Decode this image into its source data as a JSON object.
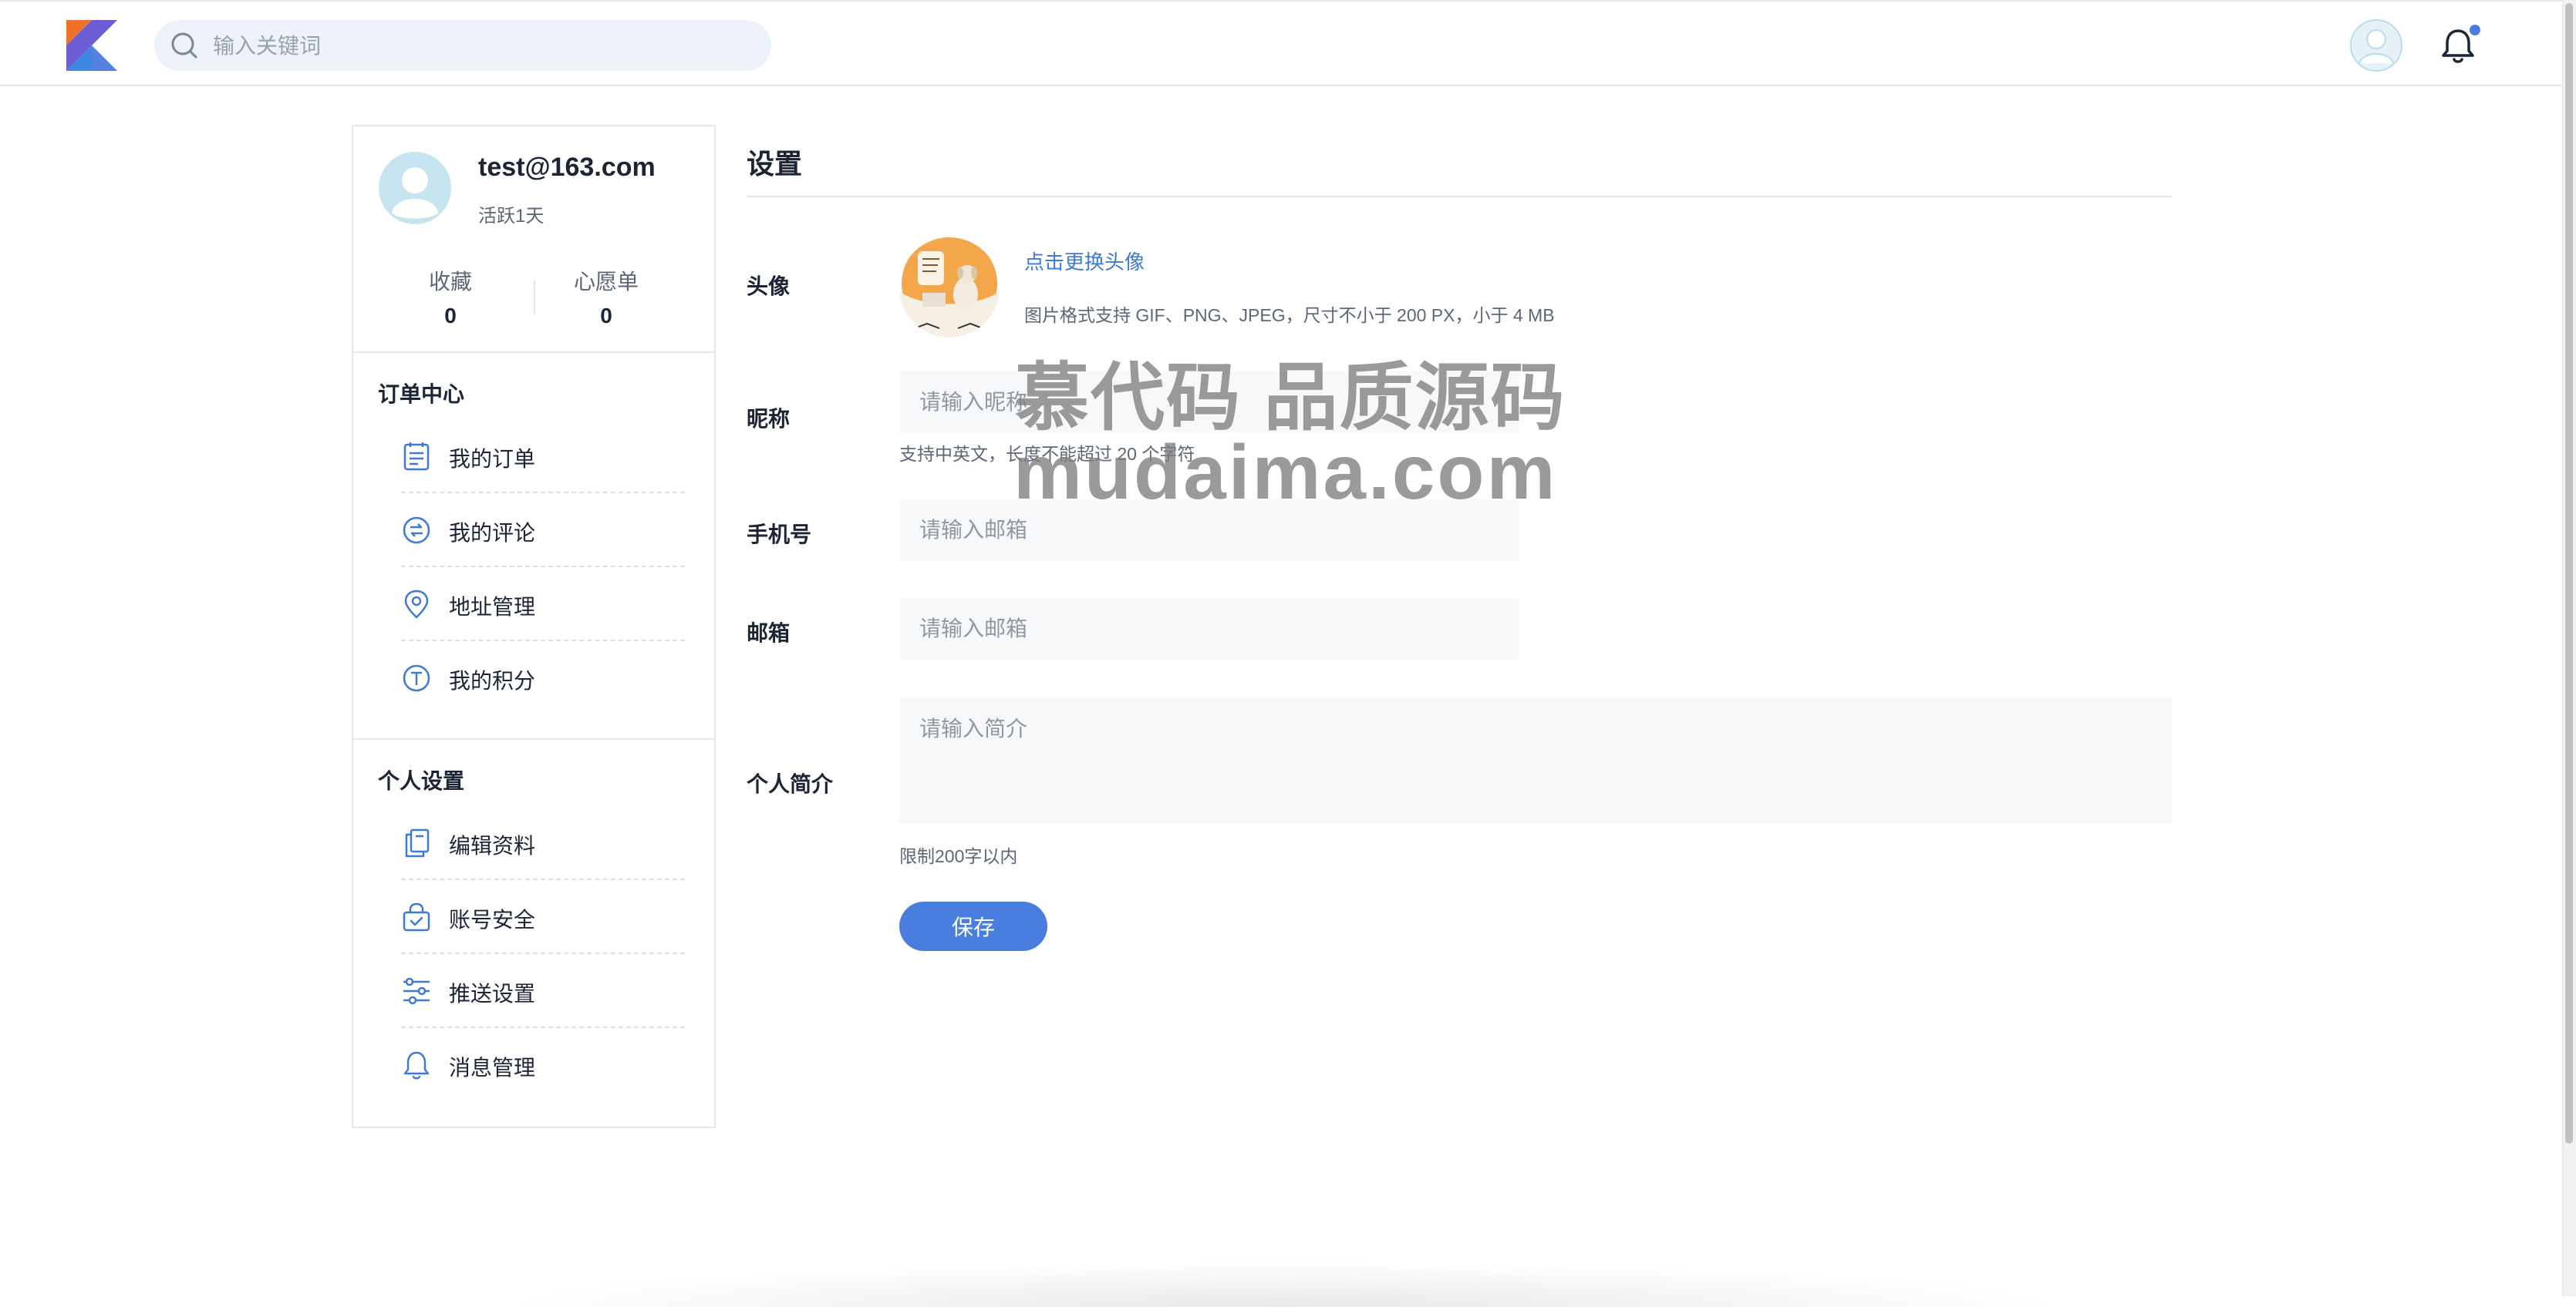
{
  "header": {
    "search_placeholder": "输入关键词",
    "brand_colors": [
      "#f0712a",
      "#6c5fd6",
      "#3f86de"
    ],
    "accent": "#4a7ede",
    "notification_dot": true
  },
  "sidebar": {
    "email": "test@163.com",
    "active": "活跃1天",
    "stats": [
      {
        "label": "收藏",
        "value": "0"
      },
      {
        "label": "心愿单",
        "value": "0"
      }
    ],
    "sections": [
      {
        "title": "订单中心",
        "items": [
          {
            "label": "我的订单",
            "icon": "order-list-icon"
          },
          {
            "label": "我的评论",
            "icon": "comment-icon"
          },
          {
            "label": "地址管理",
            "icon": "location-icon"
          },
          {
            "label": "我的积分",
            "icon": "points-icon"
          }
        ]
      },
      {
        "title": "个人设置",
        "items": [
          {
            "label": "编辑资料",
            "icon": "edit-profile-icon"
          },
          {
            "label": "账号安全",
            "icon": "security-icon"
          },
          {
            "label": "推送设置",
            "icon": "sliders-icon"
          },
          {
            "label": "消息管理",
            "icon": "bell-icon"
          }
        ]
      }
    ]
  },
  "main": {
    "title": "设置",
    "avatar": {
      "label": "头像",
      "change_link": "点击更换头像",
      "hint": "图片格式支持 GIF、PNG、JPEG，尺寸不小于 200 PX，小于 4 MB"
    },
    "nickname": {
      "label": "昵称",
      "placeholder": "请输入昵称",
      "hint": "支持中英文，长度不能超过 20 个字符"
    },
    "phone": {
      "label": "手机号",
      "placeholder": "请输入邮箱"
    },
    "email": {
      "label": "邮箱",
      "placeholder": "请输入邮箱"
    },
    "bio": {
      "label": "个人简介",
      "placeholder": "请输入简介",
      "hint": "限制200字以内"
    },
    "save_label": "保存"
  },
  "watermark": {
    "line1": "慕代码 品质源码",
    "line2": "mudaima.com"
  }
}
